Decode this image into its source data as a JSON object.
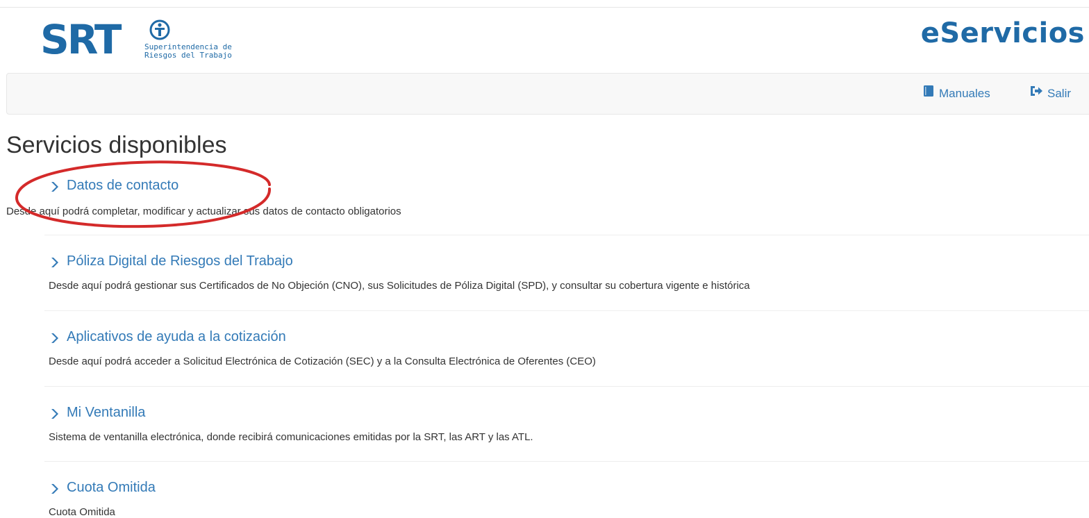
{
  "logo": {
    "letters": "SRT",
    "subtitle_line1": "Superintendencia de",
    "subtitle_line2": "Riesgos del Trabajo"
  },
  "header": {
    "brand_title": "eServicios"
  },
  "nav": {
    "manuales_label": "Manuales",
    "salir_label": "Salir"
  },
  "page_title": "Servicios disponibles",
  "services": [
    {
      "title": "Datos de contacto",
      "description": "Desde aquí podrá completar, modificar y actualizar sus datos de contacto obligatorios"
    },
    {
      "title": "Póliza Digital de Riesgos del Trabajo",
      "description": "Desde aquí podrá gestionar sus Certificados de No Objeción (CNO), sus Solicitudes de Póliza Digital (SPD), y consultar su cobertura vigente e histórica"
    },
    {
      "title": "Aplicativos de ayuda a la cotización",
      "description": "Desde aquí podrá acceder a Solicitud Electrónica de Cotización (SEC) y a la Consulta Electrónica de Oferentes (CEO)"
    },
    {
      "title": "Mi Ventanilla",
      "description": "Sistema de ventanilla electrónica, donde recibirá comunicaciones emitidas por la SRT, las ART y las ATL."
    },
    {
      "title": "Cuota Omitida",
      "description": "Cuota Omitida"
    }
  ],
  "colors": {
    "link": "#337ab7",
    "brand": "#1f6aa6",
    "annotation": "#d42a2a"
  },
  "icons": {
    "manuales": "book-icon",
    "salir": "sign-out-icon",
    "service": "chevron-right-icon"
  }
}
